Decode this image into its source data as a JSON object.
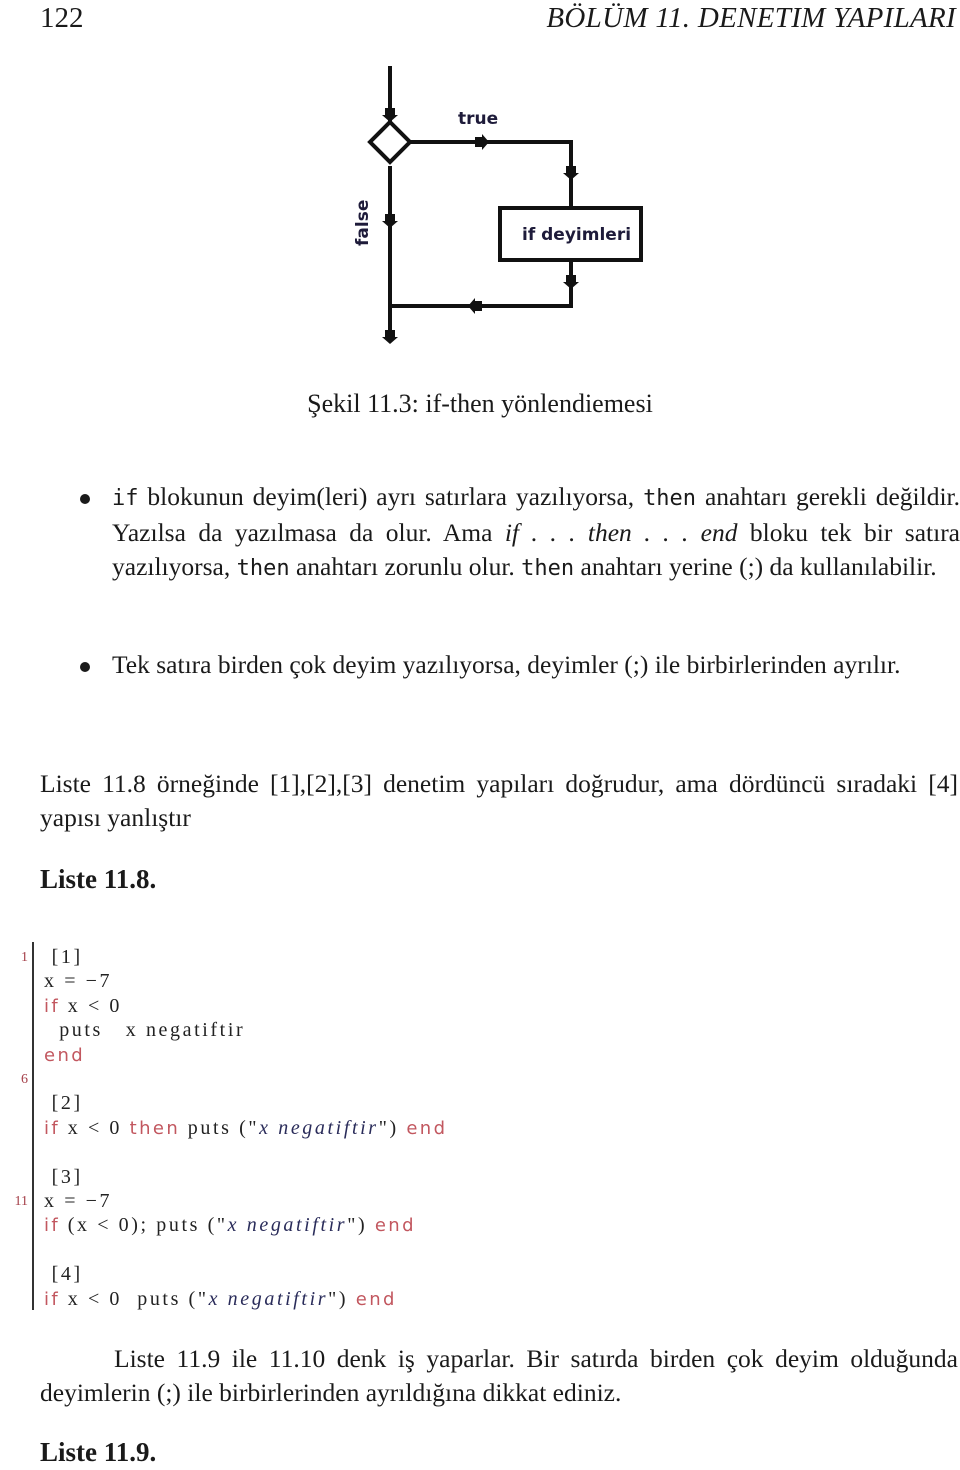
{
  "header": {
    "page_number": "122",
    "chapter_title": "BÖLÜM 11.  DENETIM YAPILARI"
  },
  "figure": {
    "caption": "Şekil 11.3: if-then yönlendiemesi",
    "flowchart": {
      "true_label": "true",
      "false_label": "false",
      "box_label": "if deyimleri",
      "colors": {
        "line": "#111111",
        "label_text": "#1e1b3a"
      }
    }
  },
  "bullets": [
    {
      "parts": [
        {
          "t": "if",
          "mono": true
        },
        {
          "t": " blokunun deyim(leri) ayrı satırlara yazılıyorsa, "
        },
        {
          "t": "then",
          "mono": true
        },
        {
          "t": " anahtarı gerekli değildir. Yazılsa da yazılmasa da olur. Ama "
        },
        {
          "t": "if . . . then . . . end",
          "italic": true
        },
        {
          "t": " bloku tek bir satıra yazılıyorsa, "
        },
        {
          "t": "then",
          "mono": true
        },
        {
          "t": " anahtarı zorunlu olur. "
        },
        {
          "t": "then",
          "mono": true
        },
        {
          "t": " anahtarı yerine (;) da kullanılabilir."
        }
      ]
    },
    {
      "parts": [
        {
          "t": "Tek satıra birden çok deyim yazılıyorsa, deyimler (;) ile birbirlerinden ayrılır."
        }
      ]
    }
  ],
  "intro_paragraph": "Liste 11.8 örneğinde [1],[2],[3] denetim yapıları doğrudur, ama dördüncü sıradaki [4] yapısı yanlıştır",
  "listing_8": {
    "title": "Liste 11.8.",
    "line_numbers": [
      {
        "label": "1",
        "line": 1
      },
      {
        "label": "6",
        "line": 6
      },
      {
        "label": "11",
        "line": 11
      }
    ],
    "lines": [
      [
        {
          "t": " [1]"
        }
      ],
      [
        {
          "t": "x = −7"
        }
      ],
      [
        {
          "t": "if",
          "kw": true
        },
        {
          "t": " x < 0"
        }
      ],
      [
        {
          "t": "  puts   x negatiftir"
        }
      ],
      [
        {
          "t": "end",
          "kw": true
        }
      ],
      [],
      [
        {
          "t": " [2]"
        }
      ],
      [
        {
          "t": "if",
          "kw": true
        },
        {
          "t": " x < 0 "
        },
        {
          "t": "then",
          "kw": true
        },
        {
          "t": " puts (\""
        },
        {
          "t": "x negatiftir",
          "str": true
        },
        {
          "t": "\") "
        },
        {
          "t": "end",
          "kw": true
        }
      ],
      [],
      [
        {
          "t": " [3]"
        }
      ],
      [
        {
          "t": "x = −7"
        }
      ],
      [
        {
          "t": "if",
          "kw": true
        },
        {
          "t": " (x < 0); puts (\""
        },
        {
          "t": "x negatiftir",
          "str": true
        },
        {
          "t": "\") "
        },
        {
          "t": "end",
          "kw": true
        }
      ],
      [],
      [
        {
          "t": " [4]"
        }
      ],
      [
        {
          "t": "if",
          "kw": true
        },
        {
          "t": " x < 0  puts (\""
        },
        {
          "t": "x negatiftir",
          "str": true
        },
        {
          "t": "\") "
        },
        {
          "t": "end",
          "kw": true
        }
      ]
    ],
    "colors": {
      "keyword": "#c2575f",
      "line_number": "#a5404a",
      "string": "#2a2c5a"
    }
  },
  "closing_paragraph": "Liste 11.9 ile 11.10 denk iş yaparlar. Bir satırda birden çok deyim olduğunda deyimlerin (;) ile birbirlerinden ayrıldığına dikkat ediniz.",
  "listing_9": {
    "title": "Liste 11.9."
  }
}
